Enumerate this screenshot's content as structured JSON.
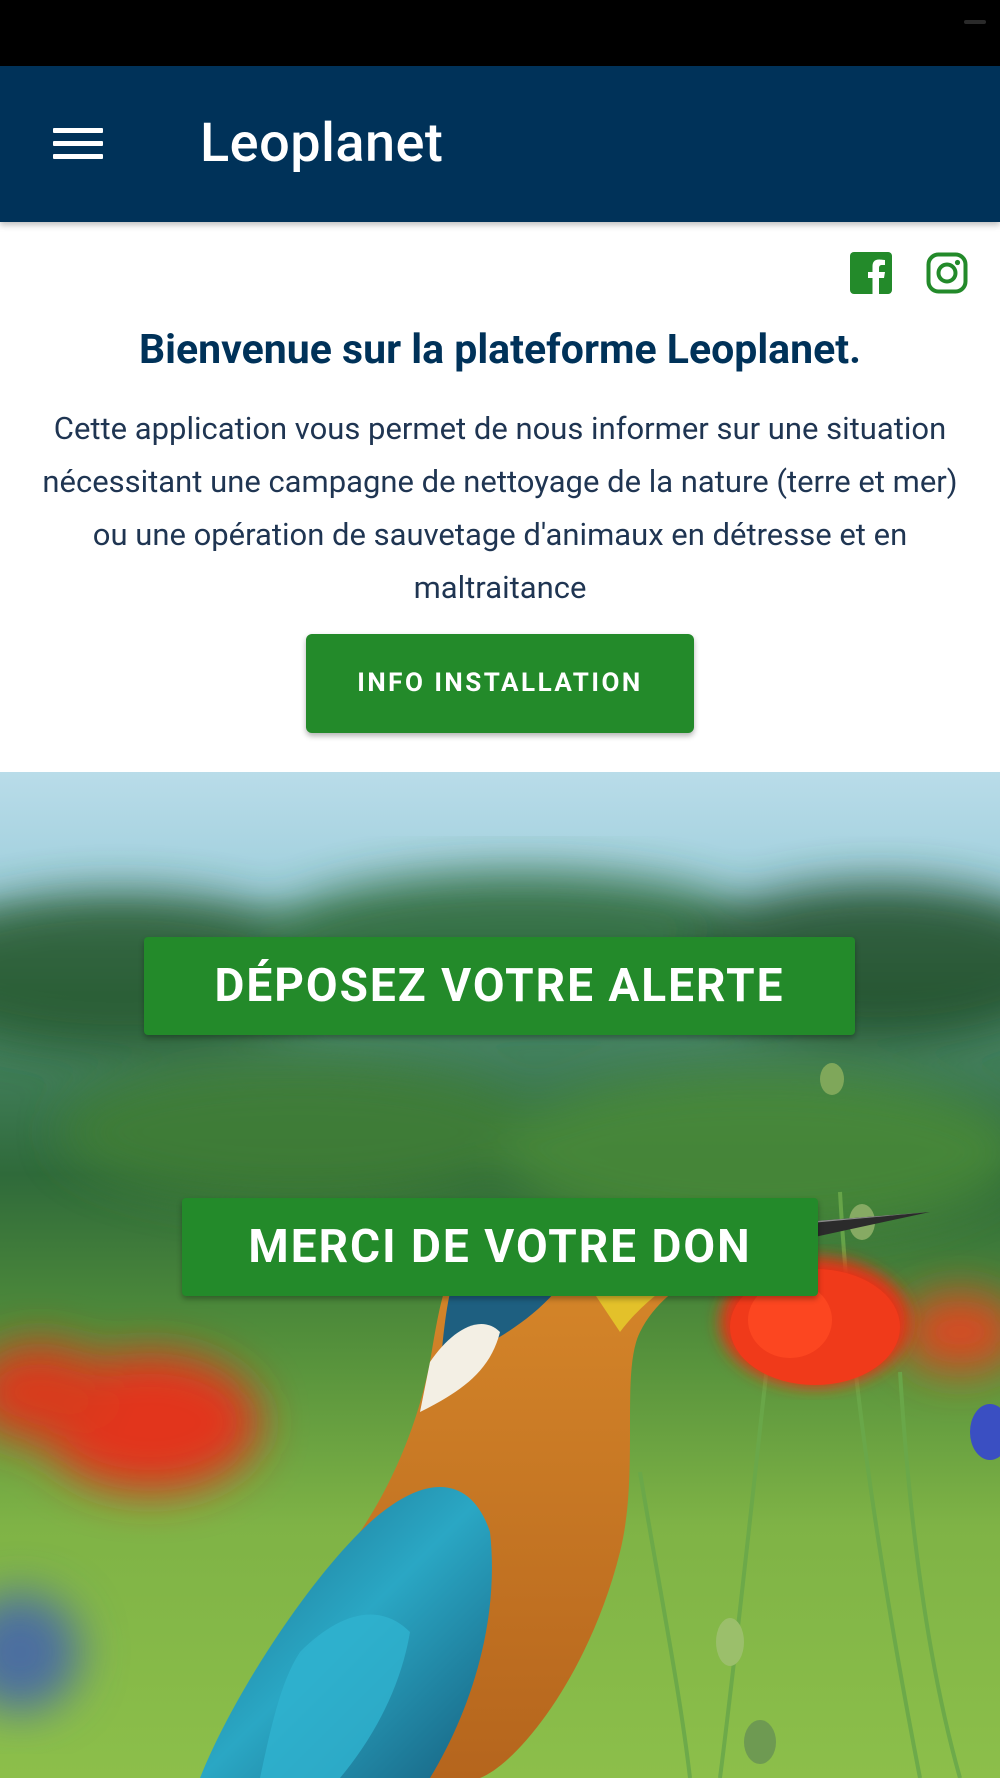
{
  "app_bar": {
    "title": "Leoplanet",
    "menu_icon": "hamburger-menu-icon"
  },
  "social": {
    "facebook_icon": "facebook-icon",
    "instagram_icon": "instagram-icon",
    "color": "#238a2a"
  },
  "welcome": {
    "title": "Bienvenue sur la plateforme Leoplanet.",
    "body": "Cette application vous permet de nous informer sur une situation nécessitant une campagne de nettoyage de la nature (terre et mer) ou une opération de sauvetage d'animaux en détresse et en maltraitance"
  },
  "buttons": {
    "info_installation": "INFO INSTALLATION",
    "alert": "DÉPOSEZ VOTRE ALERTE",
    "donate": "MERCI DE VOTRE DON"
  },
  "colors": {
    "primary": "#003259",
    "accent": "#238a2a",
    "status_bar": "#000000"
  },
  "hero_image": "kingfisher-among-poppies-photo"
}
